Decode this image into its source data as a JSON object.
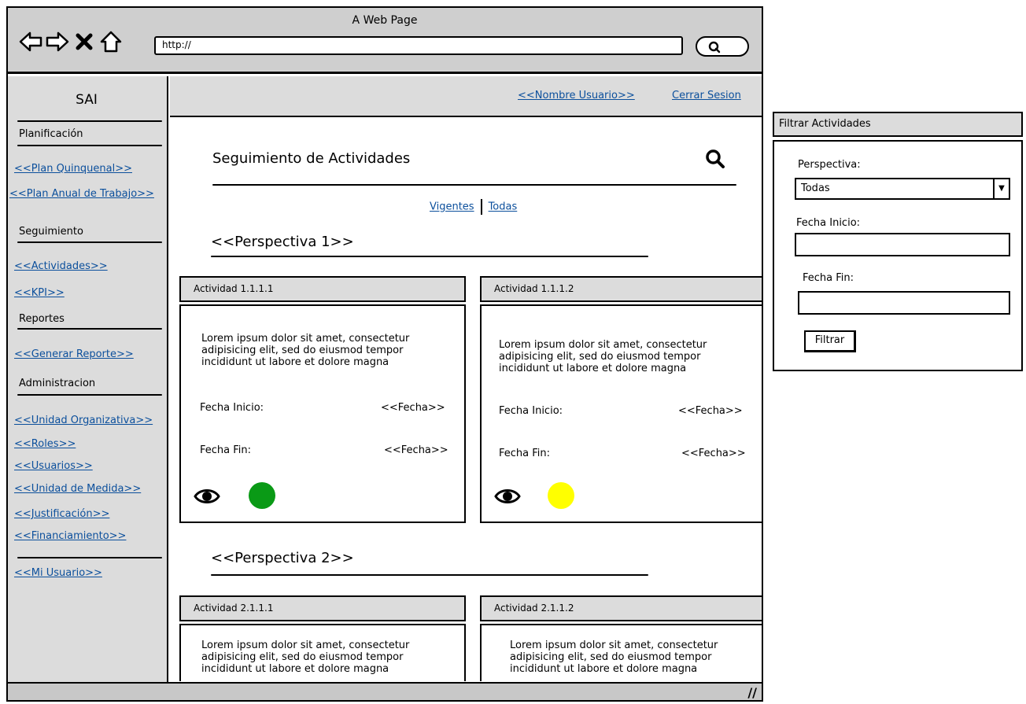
{
  "window": {
    "title": "A Web Page",
    "url": "http://"
  },
  "sidebar": {
    "app_name": "SAI",
    "sections": {
      "planificacion": "Planificación",
      "seguimiento": "Seguimiento",
      "reportes": "Reportes",
      "administracion": "Administracion"
    },
    "links": {
      "plan_quinquenal": "<<Plan Quinquenal>>",
      "plan_anual": "<<Plan Anual de Trabajo>>",
      "actividades": "<<Actividades>>",
      "kpi": "<<KPI>>",
      "generar_reporte": "<<Generar Reporte>>",
      "unidad_organizativa": "<<Unidad Organizativa>>",
      "roles": "<<Roles>>",
      "usuarios": "<<Usuarios>>",
      "unidad_medida": "<<Unidad de Medida>>",
      "justificacion": "<<Justificación>>",
      "financiamiento": "<<Financiamiento>>",
      "mi_usuario": "<<Mi Usuario>>"
    }
  },
  "header": {
    "user_name": "<<Nombre Usuario>>",
    "logout": "Cerrar Sesion"
  },
  "main": {
    "title": "Seguimiento de Actividades",
    "tabs": {
      "vigentes": "Vigentes",
      "todas": "Todas"
    },
    "perspectives": [
      {
        "title": "<<Perspectiva 1>>",
        "activities": [
          {
            "name": "Actividad 1.1.1.1",
            "description": "Lorem ipsum dolor sit amet, consectetur adipisicing elit, sed do eiusmod tempor incididunt ut labore et dolore magna",
            "start_label": "Fecha Inicio:",
            "start_value": "<<Fecha>>",
            "end_label": "Fecha Fin:",
            "end_value": "<<Fecha>>",
            "status_color": "#0a9a16"
          },
          {
            "name": "Actividad 1.1.1.2",
            "description": "Lorem ipsum dolor sit amet, consectetur adipisicing elit, sed do eiusmod tempor incididunt ut labore et dolore magna",
            "start_label": "Fecha Inicio:",
            "start_value": "<<Fecha>>",
            "end_label": "Fecha Fin:",
            "end_value": "<<Fecha>>",
            "status_color": "#ffff00"
          }
        ]
      },
      {
        "title": "<<Perspectiva 2>>",
        "activities": [
          {
            "name": "Actividad 2.1.1.1",
            "description": "Lorem ipsum dolor sit amet, consectetur adipisicing elit, sed do eiusmod tempor incididunt ut labore et dolore magna"
          },
          {
            "name": "Actividad 2.1.1.2",
            "description": "Lorem ipsum dolor sit amet, consectetur adipisicing elit, sed do eiusmod tempor incididunt ut labore et dolore magna"
          }
        ]
      }
    ]
  },
  "filter_panel": {
    "title": "Filtrar Actividades",
    "perspective_label": "Perspectiva:",
    "perspective_value": "Todas",
    "start_label": "Fecha Inicio:",
    "end_label": "Fecha Fin:",
    "start_value": "",
    "end_value": "",
    "button": "Filtrar"
  }
}
